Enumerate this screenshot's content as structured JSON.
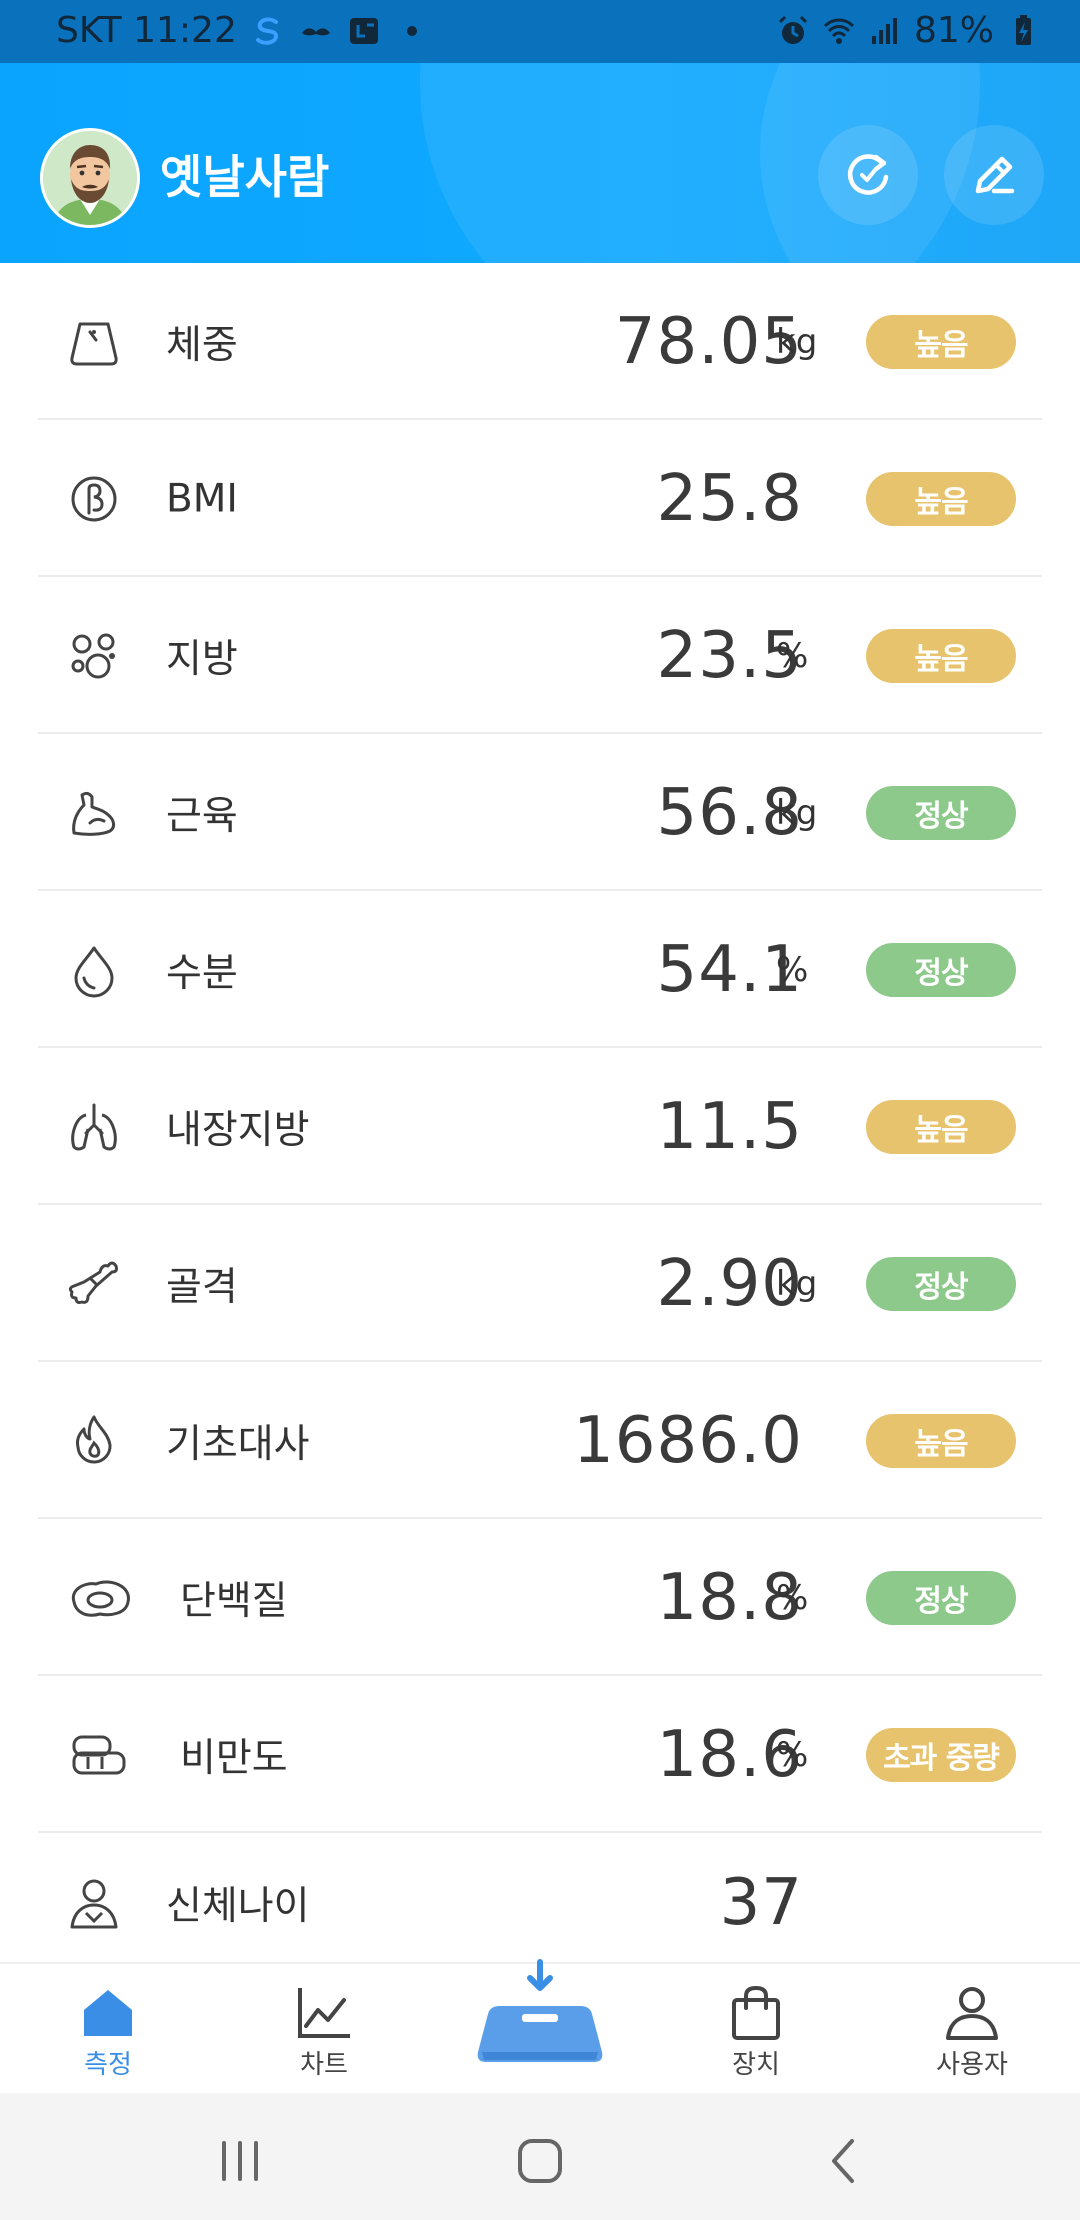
{
  "status_bar": {
    "carrier_time": "SKT 11:22",
    "battery": "81%",
    "icons": [
      "s-app-icon",
      "mustache-app-icon",
      "calendar-app-icon",
      "dot-icon",
      "alarm-icon",
      "wifi-icon",
      "signal-icon",
      "battery-charging-icon"
    ]
  },
  "header": {
    "username": "옛날사람",
    "avatar": "bearded-man-avatar",
    "actions": [
      "refresh-icon",
      "edit-icon"
    ]
  },
  "metrics": [
    {
      "label": "체중",
      "value": "78.05",
      "unit": "kg",
      "status": "높음",
      "status_color": "#e8c36e",
      "icon": "weight-icon"
    },
    {
      "label": "BMI",
      "value": "25.8",
      "unit": "",
      "status": "높음",
      "status_color": "#e8c36e",
      "icon": "bmi-icon"
    },
    {
      "label": "지방",
      "value": "23.5",
      "unit": "%",
      "status": "높음",
      "status_color": "#e8c36e",
      "icon": "fat-icon"
    },
    {
      "label": "근육",
      "value": "56.8",
      "unit": "kg",
      "status": "정상",
      "status_color": "#8ec98c",
      "icon": "muscle-icon"
    },
    {
      "label": "수분",
      "value": "54.1",
      "unit": "%",
      "status": "정상",
      "status_color": "#8ec98c",
      "icon": "water-drop-icon"
    },
    {
      "label": "내장지방",
      "value": "11.5",
      "unit": "",
      "status": "높음",
      "status_color": "#e8c36e",
      "icon": "visceral-fat-icon"
    },
    {
      "label": "골격",
      "value": "2.90",
      "unit": "kg",
      "status": "정상",
      "status_color": "#8ec98c",
      "icon": "bone-icon"
    },
    {
      "label": "기초대사",
      "value": "1686.0",
      "unit": "",
      "status": "높음",
      "status_color": "#e8c36e",
      "icon": "flame-icon"
    },
    {
      "label": "단백질",
      "value": "18.8",
      "unit": "%",
      "status": "정상",
      "status_color": "#8ec98c",
      "icon": "protein-icon"
    },
    {
      "label": "비만도",
      "value": "18.6",
      "unit": "%",
      "status": "초과 중량",
      "status_color": "#e8c36e",
      "icon": "obesity-icon"
    },
    {
      "label": "신체나이",
      "value": "37",
      "unit": "",
      "status": "",
      "status_color": "",
      "icon": "body-age-icon"
    }
  ],
  "bottom_nav": {
    "items": [
      {
        "label": "측정",
        "icon": "home-icon",
        "active": true
      },
      {
        "label": "차트",
        "icon": "chart-icon",
        "active": false
      },
      {
        "label": "",
        "icon": "scale-sync-icon",
        "active": false
      },
      {
        "label": "장치",
        "icon": "device-bag-icon",
        "active": false
      },
      {
        "label": "사용자",
        "icon": "user-icon",
        "active": false
      }
    ],
    "accent_color": "#3a8ee6"
  },
  "system_nav": [
    "recent-apps-icon",
    "home-button-icon",
    "back-icon"
  ]
}
